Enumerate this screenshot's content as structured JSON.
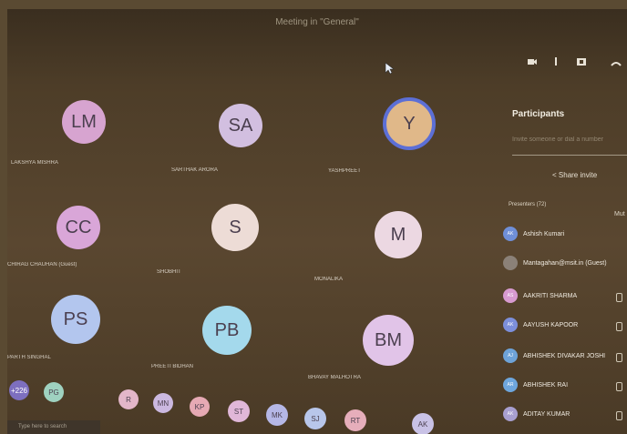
{
  "window": {
    "title": "Meeting in \"General\""
  },
  "toolbar": [
    "video-icon",
    "hand-icon",
    "share-icon",
    "leave-icon"
  ],
  "grid": [
    {
      "initials": "LM",
      "name": "LAKSHYA MISHRA",
      "color": "#d7a4d0"
    },
    {
      "initials": "SA",
      "name": "SARTHAK ARORA",
      "color": "#d2bfe0"
    },
    {
      "initials": "Y",
      "name": "YASHPREET",
      "color": "#e0b889",
      "ring": "#5c6fd6"
    },
    {
      "initials": "CC",
      "name": "CHIRAG CHAUHAN (Guest)",
      "color": "#d9a6d8"
    },
    {
      "initials": "S",
      "name": "SHOBHIT",
      "color": "#eddcd6"
    },
    {
      "initials": "M",
      "name": "MONALIKA",
      "color": "#ecd8e2"
    },
    {
      "initials": "PS",
      "name": "PARTH SINGHAL",
      "color": "#b3c6ee"
    },
    {
      "initials": "PB",
      "name": "PREETI BIDHAN",
      "color": "#a4d9ec"
    },
    {
      "initials": "BM",
      "name": "BHAVAY MALHOTRA",
      "color": "#e1c4e8"
    }
  ],
  "tray": [
    {
      "text": "+226",
      "color": "#7d6fbf"
    },
    {
      "text": "PG",
      "color": "#9fd2c0"
    },
    {
      "text": "R",
      "color": "#e3b6c9"
    },
    {
      "text": "MN",
      "color": "#cbb8e0"
    },
    {
      "text": "KP",
      "color": "#e6a9b4"
    },
    {
      "text": "ST",
      "color": "#e0b7d8"
    },
    {
      "text": "MK",
      "color": "#b5b7e6"
    },
    {
      "text": "SJ",
      "color": "#b8c6ea"
    },
    {
      "text": "RT",
      "color": "#e6aebb"
    },
    {
      "text": "AK",
      "color": "#c9c2e6"
    }
  ],
  "panel": {
    "title": "Participants",
    "search_placeholder": "Invite someone or dial a number",
    "share_label": "Share invite",
    "section_label": "Presenters (72)",
    "mute_label": "Mut",
    "participants": [
      {
        "initials": "AK",
        "name": "Ashish Kumari",
        "color": "#6f8fd8"
      },
      {
        "initials": "",
        "name": "Mantagahan@msit.in (Guest)",
        "color": "#8b8178"
      },
      {
        "initials": "AS",
        "name": "AAKRITI SHARMA",
        "color": "#d79ad0"
      },
      {
        "initials": "AK",
        "name": "AAYUSH KAPOOR",
        "color": "#7c8fdb"
      },
      {
        "initials": "AJ",
        "name": "ABHISHEK DIVAKAR JOSHI",
        "color": "#6ea3d8"
      },
      {
        "initials": "AR",
        "name": "ABHISHEK RAI",
        "color": "#6ea6dd"
      },
      {
        "initials": "AK",
        "name": "ADITAY KUMAR",
        "color": "#a89fd0"
      }
    ]
  },
  "taskbar": {
    "search_placeholder": "Type here to search"
  }
}
